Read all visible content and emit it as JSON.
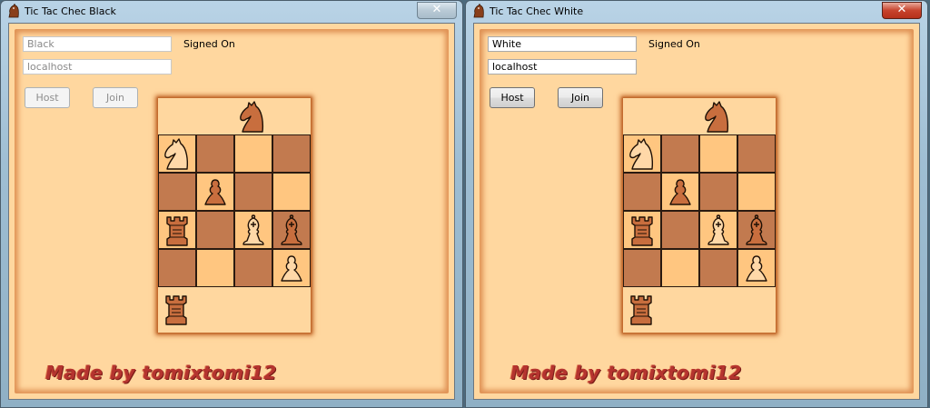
{
  "windows": [
    {
      "title": "Tic Tac Chec Black",
      "name_field": "Black",
      "host_field": "localhost",
      "status": "Signed On",
      "host_button": "Host",
      "join_button": "Join",
      "close_label": "✕",
      "credit": "Made by tomixtomi12"
    },
    {
      "title": "Tic Tac Chec White",
      "name_field": "White",
      "host_field": "localhost",
      "status": "Signed On",
      "host_button": "Host",
      "join_button": "Join",
      "close_label": "✕",
      "credit": "Made by tomixtomi12"
    }
  ],
  "board": {
    "colors": {
      "dark": "#c27a4f",
      "light": "#ffc680",
      "outside": "#ffd79f"
    },
    "reserve_top": [
      "",
      "",
      "dark-knight",
      ""
    ],
    "squares": [
      [
        "light-knight",
        "dark",
        "light",
        "dark"
      ],
      [
        "dark",
        "dark-pawn",
        "dark",
        "light"
      ],
      [
        "dark-rook",
        "dark",
        "light-bishop",
        "dark-bishop"
      ],
      [
        "dark",
        "light",
        "dark",
        "light-pawn"
      ]
    ],
    "reserve_bottom": [
      "dark-rook",
      "",
      "",
      ""
    ]
  }
}
